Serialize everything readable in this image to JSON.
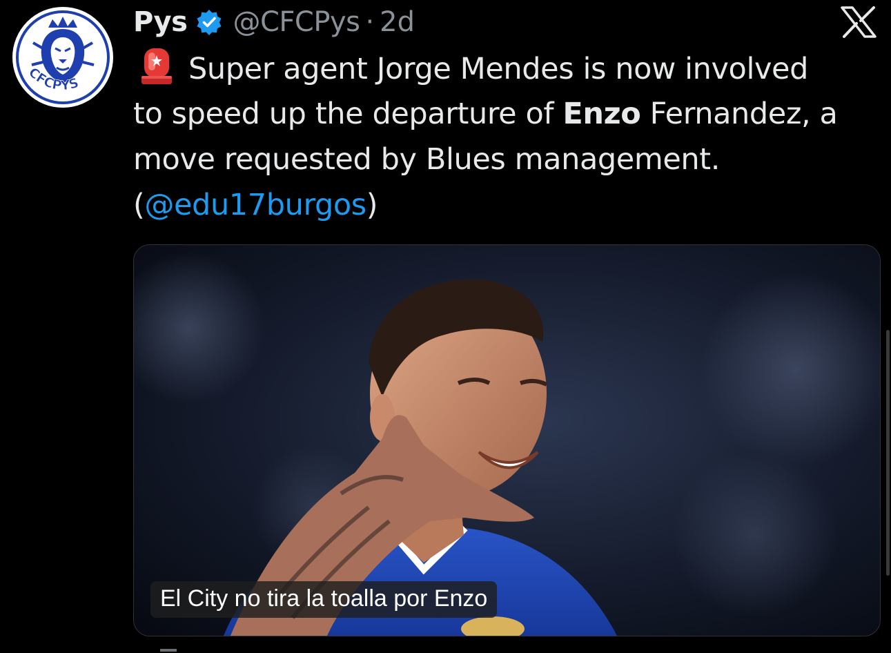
{
  "tweet": {
    "author_name": "Pys",
    "author_handle": "@CFCPys",
    "separator": "·",
    "timestamp": "2d",
    "avatar_text": "CFCPYS",
    "text_lines": [
      {
        "before": "Super agent Jorge Mendes is now involved",
        "bold": "",
        "after": ""
      },
      {
        "before": "to speed up the departure of ",
        "bold": "Enzo",
        "after": " Fernandez, a"
      },
      {
        "before": "move requested by Blues management.",
        "bold": "",
        "after": ""
      },
      {
        "open": "(",
        "mention": "@edu17burgos",
        "close": ")"
      }
    ],
    "media": {
      "caption": "El City no tira la toalla por Enzo"
    }
  },
  "icons": {
    "verified": "verified-badge-icon",
    "siren": "police-light-emoji-icon",
    "platform": "x-logo-icon"
  },
  "colors": {
    "background": "#000000",
    "text_primary": "#e7e9ea",
    "text_secondary": "#8b9198",
    "mention": "#1d9bf0",
    "verified": "#1d9bf0",
    "avatar_blue": "#1f3fae"
  }
}
